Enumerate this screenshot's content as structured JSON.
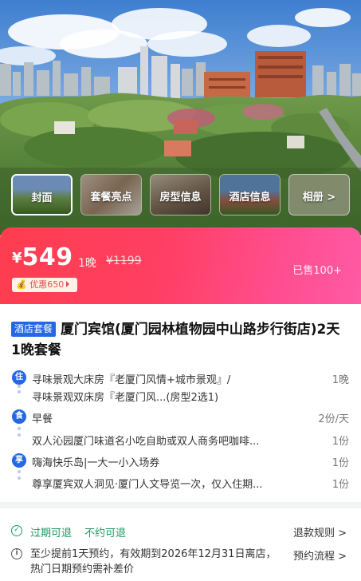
{
  "gallery": {
    "tabs": [
      {
        "label": "封面",
        "active": true
      },
      {
        "label": "套餐亮点",
        "active": false
      },
      {
        "label": "房型信息",
        "active": false
      },
      {
        "label": "酒店信息",
        "active": false
      },
      {
        "label": "相册 >",
        "active": false
      }
    ]
  },
  "price": {
    "currency": "¥",
    "amount": "549",
    "nights": "1晚",
    "original": "¥1199",
    "sold": "已售100+",
    "coupon": "优惠650",
    "coupon_icon": "coupon-bag-icon"
  },
  "package": {
    "tag": "酒店套餐",
    "title": "厦门宾馆(厦门园林植物园中山路步行街店)2天1晚套餐",
    "sections": [
      {
        "icon": "住",
        "items": [
          {
            "text": "寻味景观大床房『老厦门风情+城市景观』/",
            "qty": "1晚"
          },
          {
            "text": "寻味景观双床房『老厦门风...(房型2选1)",
            "qty": ""
          }
        ]
      },
      {
        "icon": "食",
        "items": [
          {
            "text": "早餐",
            "qty": "2份/天"
          },
          {
            "text": "双人沁园厦门味道名小吃自助或双人商务吧咖啡...",
            "qty": "1份"
          }
        ]
      },
      {
        "icon": "享",
        "items": [
          {
            "text": "嗨海快乐岛|一大一小入场券",
            "qty": "1份"
          },
          {
            "text": "尊享厦宾双人洞见·厦门人文导览一次，仅入住期...",
            "qty": "1份"
          }
        ]
      }
    ]
  },
  "policy": {
    "refundable": "过期可退",
    "no_reservation": "不约可退",
    "refund_rules": "退款规则 >",
    "notice": "至少提前1天预约，有效期到2026年12月31日离店，热门日期预约需补差价",
    "booking_flow": "预约流程 >"
  },
  "colors": {
    "accent_blue": "#2468e8",
    "price_gradient_start": "#ff3d4f",
    "price_gradient_end": "#ff5aa4",
    "green": "#1a9a63"
  }
}
